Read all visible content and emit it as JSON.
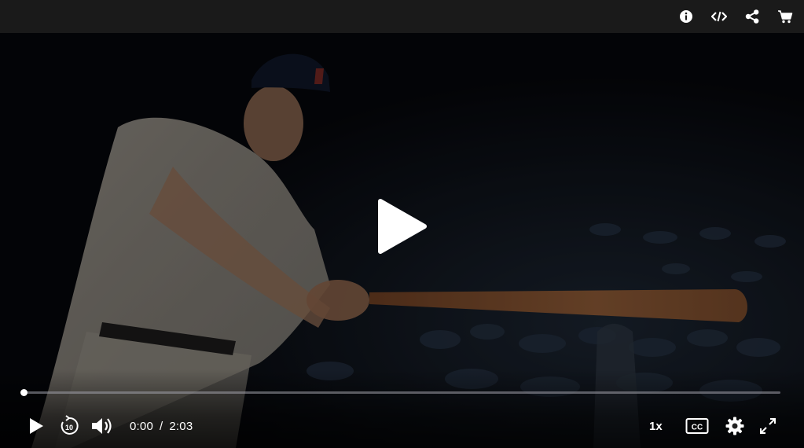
{
  "player": {
    "current_time": "0:00",
    "time_separator": "/",
    "duration": "2:03",
    "playback_speed": "1x",
    "progress_fraction": 0.0,
    "accent_color": "#ffffff"
  },
  "topbar_icons": [
    "info-icon",
    "embed-code-icon",
    "share-icon",
    "cart-icon"
  ],
  "controls_icons": [
    "play-icon",
    "rewind-10-icon",
    "volume-icon",
    "closed-captions-icon",
    "settings-gear-icon",
    "fullscreen-icon"
  ],
  "rewind_seconds": "10",
  "cc_label": "CC"
}
